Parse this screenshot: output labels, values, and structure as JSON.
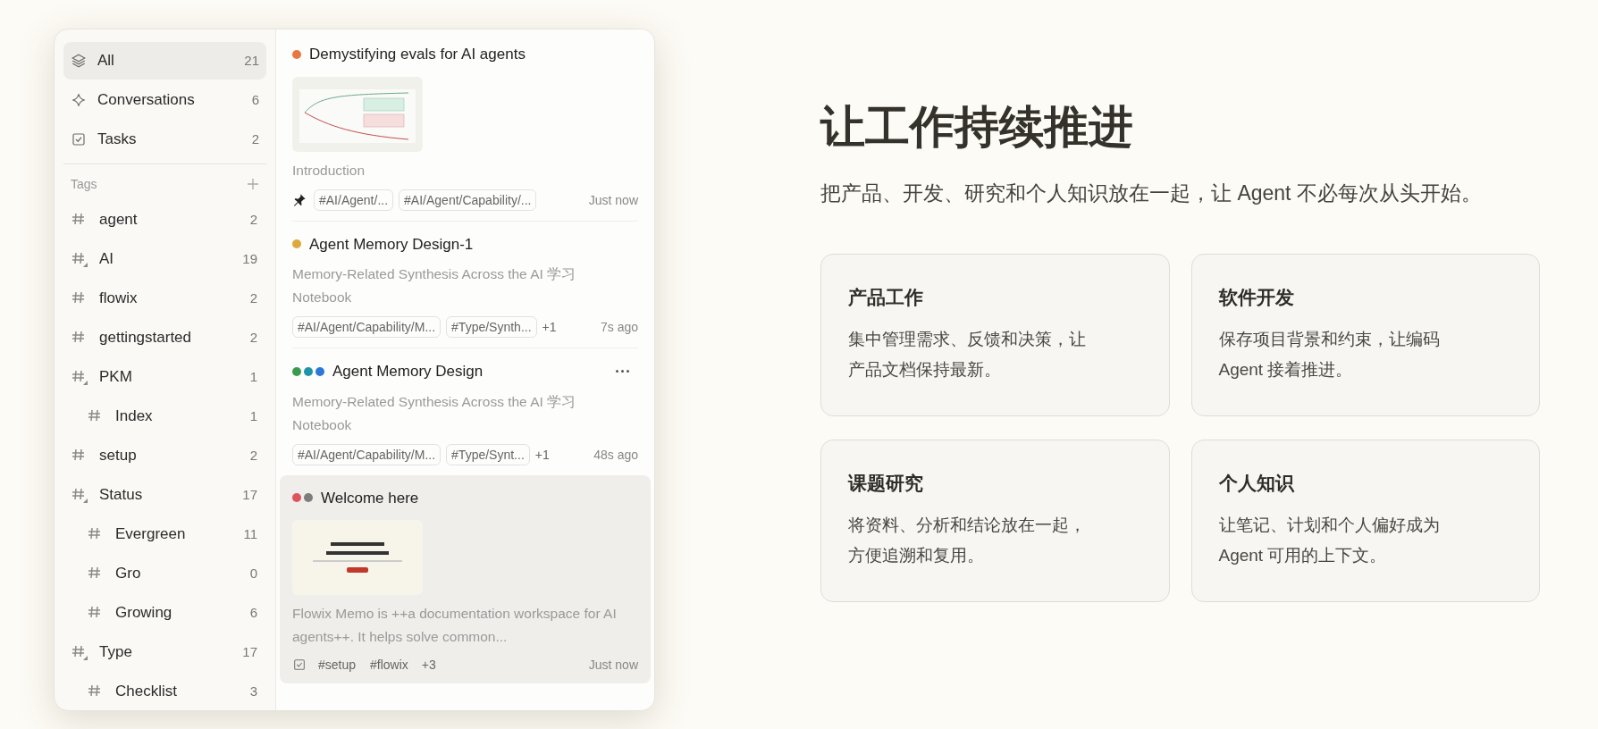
{
  "sidebar": {
    "nav": [
      {
        "kind": "layers",
        "label": "All",
        "count": "21",
        "selected": true
      },
      {
        "kind": "sparkle",
        "label": "Conversations",
        "count": "6",
        "selected": false
      },
      {
        "kind": "task",
        "label": "Tasks",
        "count": "2",
        "selected": false
      }
    ],
    "tags_heading": "Tags",
    "tags": [
      {
        "label": "agent",
        "count": "2"
      },
      {
        "label": "AI",
        "count": "19",
        "collapsed": true
      },
      {
        "label": "flowix",
        "count": "2"
      },
      {
        "label": "gettingstarted",
        "count": "2"
      },
      {
        "label": "PKM",
        "count": "1",
        "children": [
          {
            "label": "Index",
            "count": "1"
          }
        ]
      },
      {
        "label": "setup",
        "count": "2"
      },
      {
        "label": "Status",
        "count": "17",
        "children": [
          {
            "label": "Evergreen",
            "count": "11"
          },
          {
            "label": "Gro",
            "count": "0"
          },
          {
            "label": "Growing",
            "count": "6"
          }
        ]
      },
      {
        "label": "Type",
        "count": "17",
        "children": [
          {
            "label": "Checklist",
            "count": "3"
          }
        ]
      }
    ]
  },
  "notes": [
    {
      "title": "Demystifying evals for AI agents",
      "dots": [
        {
          "color": "#e8783f"
        }
      ],
      "image": {
        "kind": "chart"
      },
      "excerpt": "Introduction",
      "pinned": true,
      "task": false,
      "tags": [
        "#AI/Agent/...",
        "#AI/Agent/Capability/..."
      ],
      "time": "Just now",
      "selected": false,
      "menu": false
    },
    {
      "title": "Agent Memory Design-1",
      "dots": [
        {
          "color": "#dcaa3c"
        }
      ],
      "excerpt": "Memory-Related Synthesis Across the AI 学习 Notebook",
      "pinned": false,
      "task": false,
      "tags": [
        "#AI/Agent/Capability/M...",
        "#Type/Synth..."
      ],
      "extra": "+1",
      "time": "7s ago",
      "selected": false,
      "menu": false
    },
    {
      "title": "Agent Memory Design",
      "dots": [
        {
          "color": "#3a9a4f"
        },
        {
          "color": "#1f94a8"
        },
        {
          "color": "#2a78d8"
        }
      ],
      "excerpt": "Memory-Related Synthesis Across the AI 学习 Notebook",
      "pinned": false,
      "task": false,
      "tags": [
        "#AI/Agent/Capability/M...",
        "#Type/Synt..."
      ],
      "extra": "+1",
      "time": "48s ago",
      "selected": false,
      "menu": true
    },
    {
      "title": "Welcome here",
      "dots": [
        {
          "color": "#e0525c"
        },
        {
          "color": "#7d7d7d"
        }
      ],
      "image": {
        "kind": "website"
      },
      "excerpt": "Flowix Memo is ++a documentation workspace for AI agents++. It helps solve common...",
      "pinned": false,
      "task": true,
      "tags": [
        "#setup",
        "#flowix"
      ],
      "extra": "+3",
      "time": "Just now",
      "selected": true,
      "menu": false
    }
  ],
  "hero": {
    "title": "让工作持续推进",
    "subtitle": "把产品、开发、研究和个人知识放在一起，让 Agent 不必每次从头开始。"
  },
  "cards": [
    {
      "title": "产品工作",
      "text": "集中管理需求、反馈和决策，让产品文档保持最新。"
    },
    {
      "title": "软件开发",
      "text": "保存项目背景和约束，让编码 Agent 接着推进。"
    },
    {
      "title": "课题研究",
      "text": "将资料、分析和结论放在一起，方便追溯和复用。"
    },
    {
      "title": "个人知识",
      "text": "让笔记、计划和个人偏好成为 Agent 可用的上下文。"
    }
  ]
}
